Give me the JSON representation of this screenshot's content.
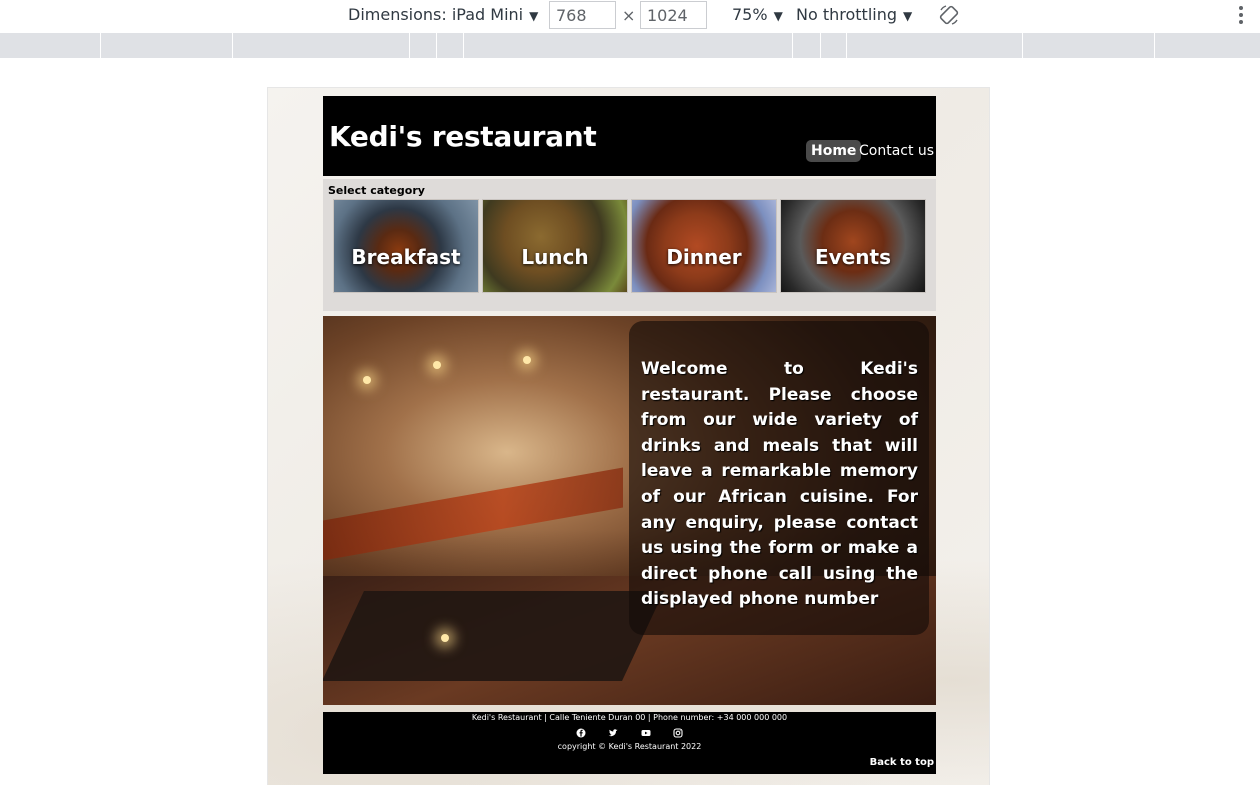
{
  "devtools": {
    "dimensions_label": "Dimensions: iPad Mini",
    "width": "768",
    "height": "1024",
    "zoom": "75%",
    "throttling": "No throttling",
    "times": "×"
  },
  "site": {
    "brand": "Kedi's restaurant",
    "nav": {
      "home": "Home",
      "contact": "Contact us"
    },
    "categories": {
      "title": "Select category",
      "items": [
        "Breakfast",
        "Lunch",
        "Dinner",
        "Events"
      ]
    },
    "hero": {
      "text": "Welcome to Kedi's restaurant. Please choose from our wide variety of drinks and meals that will leave a remarkable memory of our African cuisine. For any enquiry, please contact us using the form or make a direct phone call using the displayed phone number"
    },
    "footer": {
      "address": "Kedi's Restaurant | Calle Teniente Duran 00 | Phone number: +34 000 000 000",
      "copyright": "copyright © Kedi's Restaurant 2022",
      "back_to_top": "Back to top",
      "socials": [
        "facebook-icon",
        "twitter-icon",
        "youtube-icon",
        "instagram-icon"
      ]
    }
  }
}
